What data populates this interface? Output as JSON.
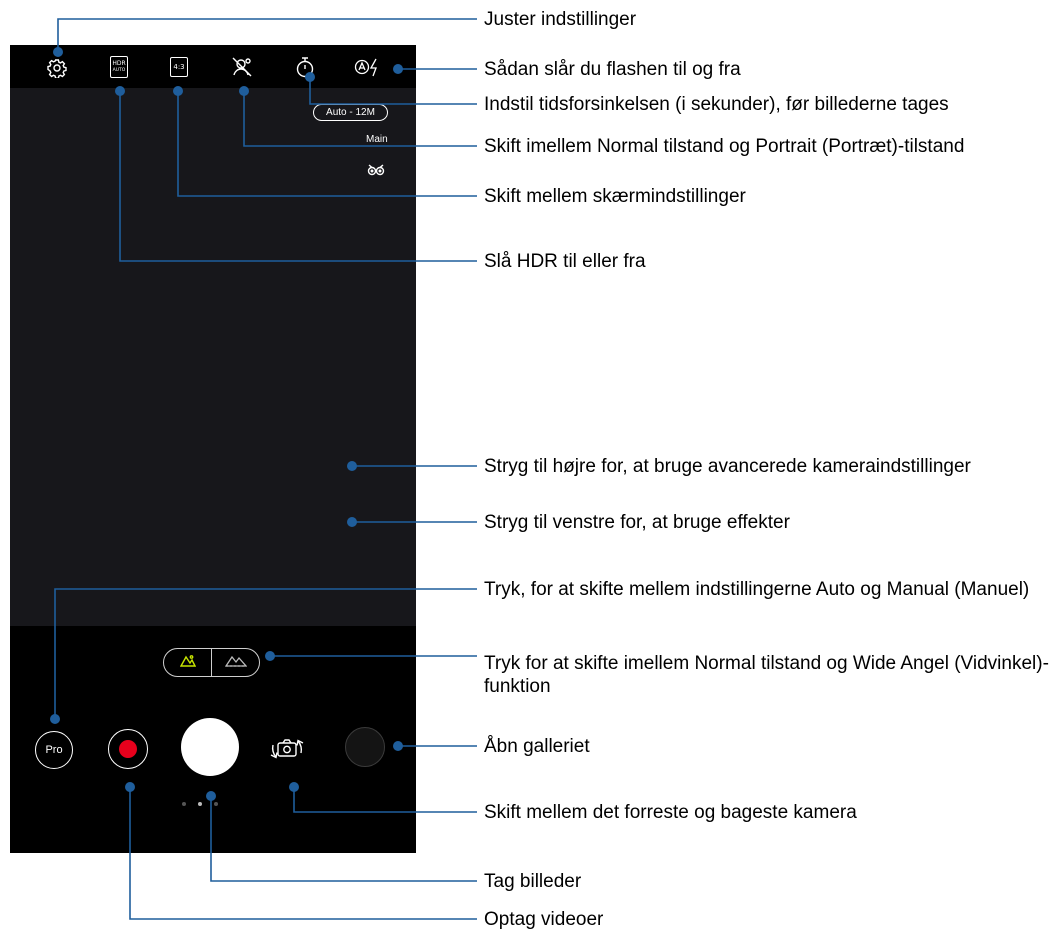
{
  "camera": {
    "hdr_top": "HDR",
    "hdr_bottom": "AUTO",
    "aspect_ratio": "4:3",
    "resolution": "Auto - 12M",
    "lens": "Main",
    "pro_label": "Pro",
    "page_dots": 3,
    "active_page": 2,
    "accent_color": "#c8e600",
    "record_color": "#e8001c"
  },
  "icons": {
    "settings": "gear-icon",
    "hdr": "hdr-icon",
    "aspect_ratio": "aspect-ratio-icon",
    "portrait": "portrait-off-icon",
    "timer": "timer-icon",
    "flash": "flash-auto-icon",
    "owl": "owl-icon",
    "normal_lens": "mountain-icon",
    "wide_lens": "wide-mountain-icon",
    "switch_camera": "switch-camera-icon"
  },
  "callouts": {
    "settings": "Juster indstillinger",
    "flash": "Sådan slår du flashen til og fra",
    "timer": "Indstil tidsforsinkelsen (i sekunder), før billederne tages",
    "portrait": "Skift imellem Normal tilstand og Portrait (Portræt)-tilstand",
    "aspect": "Skift mellem skærmindstillinger",
    "hdr": "Slå HDR til eller fra",
    "swipe_right": "Stryg til højre for, at bruge avancerede kameraindstillinger",
    "swipe_left": "Stryg til venstre for, at bruge effekter",
    "pro": "Tryk, for at skifte mellem indstillingerne Auto og Manual (Manuel)",
    "wide": "Tryk for at skifte imellem Normal tilstand og Wide Angel (Vidvinkel)-funktion",
    "gallery": "Åbn galleriet",
    "switch_camera": "Skift mellem det forreste og bageste kamera",
    "photo": "Tag billeder",
    "video": "Optag videoer"
  }
}
